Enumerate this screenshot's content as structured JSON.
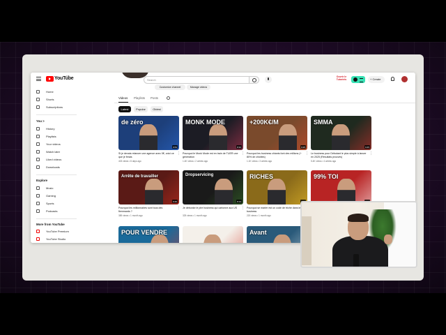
{
  "masthead": {
    "logo_text": "YouTube",
    "country": "FR",
    "search_placeholder": "Search",
    "promo_line1": "Ouvrir le",
    "promo_line2": "Tutoriels",
    "create_label": "+ Create"
  },
  "sidebar": {
    "items_main": [
      "Home",
      "Shorts",
      "Subscriptions"
    ],
    "you_heading": "You >",
    "items_you": [
      "History",
      "Playlists",
      "Your videos",
      "Watch later",
      "Liked videos",
      "Downloads"
    ],
    "explore_heading": "Explore",
    "items_explore": [
      "Music",
      "Gaming",
      "Sports",
      "Podcasts"
    ],
    "more_heading": "More from YouTube",
    "items_more": [
      "YouTube Premium",
      "YouTube Studio"
    ]
  },
  "channel": {
    "customize_label": "Customize channel",
    "manage_label": "Manage videos"
  },
  "tabs": [
    "Videos",
    "Playlists",
    "Posts"
  ],
  "chips": [
    "Latest",
    "Popular",
    "Oldest"
  ],
  "videos": [
    {
      "title": "Si je devais relancer une agence avec 0€, voici ce que je ferais",
      "meta": "403 views • 8 days ago",
      "duration": "9:53",
      "thumb_text": "de zéro",
      "bg": "#1d3f7a",
      "accent": "#2a6bd4"
    },
    {
      "title": "Pourquoi le Monk Mode est en train de TUER une génération",
      "meta": "1.4K views • 2 weeks ago",
      "duration": "8:32",
      "thumb_text": "MONK MODE",
      "bg": "#1c1c24",
      "accent": "#d23a5a"
    },
    {
      "title": "Pourquoi les business chiants font des millions (+ 80% de chiottes)",
      "meta": "1.1K views • 3 weeks ago",
      "duration": "9:25",
      "thumb_text": "+200K€/M",
      "bg": "#7a4a2c",
      "accent": "#d84a2a"
    },
    {
      "title": "Le business pour Débutant le plus simple à lancer en 2025 (Résultats prouvés)",
      "meta": "5.4K views • 4 weeks ago",
      "duration": "9:45",
      "thumb_text": "SMMA",
      "bg": "#1f2a1f",
      "accent": "#e03030"
    },
    {
      "title": "Pourquoi les millionnaires sont tous des flemmards ?",
      "meta": "389 views • 1 month ago",
      "duration": "9:46",
      "thumb_text": "Arrête de travailler",
      "bg": "#5a1a16",
      "accent": "#d03020"
    },
    {
      "title": "Je débunke le pire business qui cartonne aux US",
      "meta": "325 views • 1 month ago",
      "duration": "8:13",
      "thumb_text": "Dropservicing",
      "bg": "#1a1a1a",
      "accent": "#3a7a2a"
    },
    {
      "title": "Pourquoi se marier est un code de triche dans le business",
      "meta": "220 views • 1 month ago",
      "duration": "8:09",
      "thumb_text": "RICHES",
      "bg": "#8a6a1a",
      "accent": "#f2c52a"
    },
    {
      "title": "",
      "meta": "",
      "duration": "8:54",
      "thumb_text": "99% TOI",
      "bg": "#b82424",
      "accent": "#ffffff"
    },
    {
      "title": "",
      "meta": "",
      "duration": "",
      "thumb_text": "POUR VENDRE",
      "bg": "#1a6a9a",
      "accent": "#e0302a"
    },
    {
      "title": "",
      "meta": "",
      "duration": "",
      "thumb_text": "",
      "bg": "#f4f0ea",
      "accent": "#d03020"
    },
    {
      "title": "",
      "meta": "",
      "duration": "",
      "thumb_text": "Avant",
      "bg": "#2a5a7a",
      "accent": "#ffffff"
    }
  ],
  "colors": {
    "brand_red": "#ff0000",
    "studio_accent": "#38e2b5"
  }
}
